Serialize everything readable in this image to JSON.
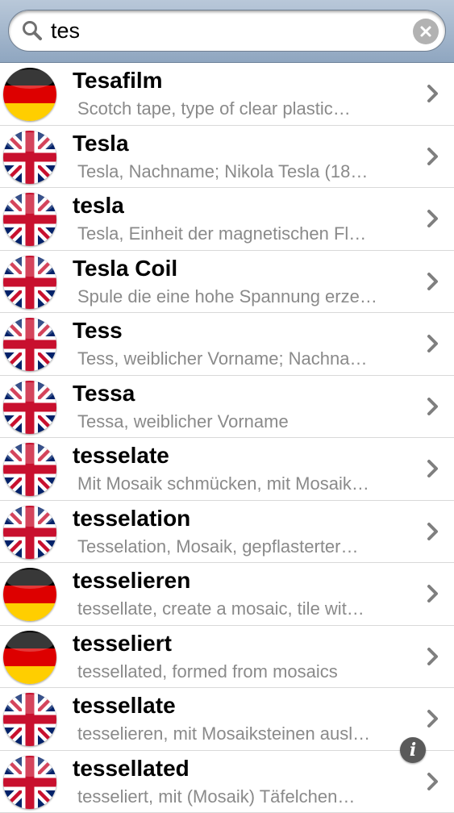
{
  "search": {
    "value": "tes",
    "placeholder": ""
  },
  "colors": {
    "chevron": "#7f7f7f",
    "definition_text": "#8a8a8a",
    "search_bar": "#a4b6cb"
  },
  "icons": {
    "search": "magnifier-icon",
    "clear": "clear-icon",
    "chevron": "chevron-right-icon",
    "info": "info-icon"
  },
  "info_label": "i",
  "results": [
    {
      "flag": "de",
      "term": "Tesafilm",
      "definition": "Scotch tape, type of clear plastic…"
    },
    {
      "flag": "uk",
      "term": "Tesla",
      "definition": "Tesla, Nachname; Nikola Tesla (18…"
    },
    {
      "flag": "uk",
      "term": "tesla",
      "definition": "Tesla, Einheit der magnetischen Fl…"
    },
    {
      "flag": "uk",
      "term": "Tesla Coil",
      "definition": "Spule die eine hohe Spannung erze…"
    },
    {
      "flag": "uk",
      "term": "Tess",
      "definition": "Tess, weiblicher Vorname; Nachna…"
    },
    {
      "flag": "uk",
      "term": "Tessa",
      "definition": "Tessa, weiblicher Vorname"
    },
    {
      "flag": "uk",
      "term": "tesselate",
      "definition": "Mit Mosaik schmücken, mit Mosaik…"
    },
    {
      "flag": "uk",
      "term": "tesselation",
      "definition": "Tesselation, Mosaik, gepflasterter…"
    },
    {
      "flag": "de",
      "term": "tesselieren",
      "definition": "tessellate, create a mosaic, tile wit…"
    },
    {
      "flag": "de",
      "term": "tesseliert",
      "definition": "tessellated, formed from mosaics"
    },
    {
      "flag": "uk",
      "term": "tessellate",
      "definition": "tesselieren, mit Mosaiksteinen ausl…"
    },
    {
      "flag": "uk",
      "term": "tessellated",
      "definition": "tesseliert, mit (Mosaik) Täfelchen…"
    }
  ]
}
